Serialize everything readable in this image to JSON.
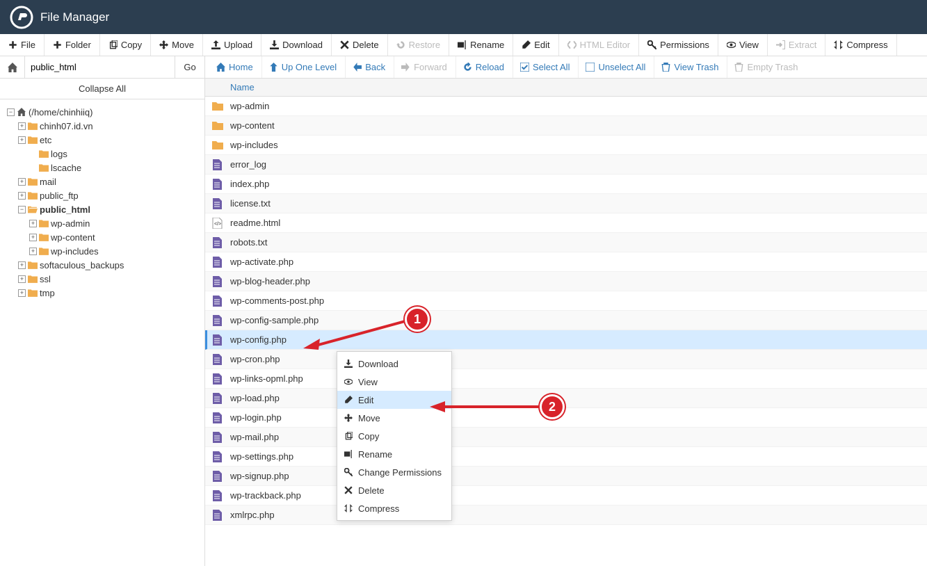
{
  "app_title": "File Manager",
  "toolbar": [
    {
      "id": "file",
      "label": "File",
      "icon": "plus"
    },
    {
      "id": "folder",
      "label": "Folder",
      "icon": "plus"
    },
    {
      "id": "copy",
      "label": "Copy",
      "icon": "copy"
    },
    {
      "id": "move",
      "label": "Move",
      "icon": "move"
    },
    {
      "id": "upload",
      "label": "Upload",
      "icon": "upload"
    },
    {
      "id": "download",
      "label": "Download",
      "icon": "download"
    },
    {
      "id": "delete",
      "label": "Delete",
      "icon": "x"
    },
    {
      "id": "restore",
      "label": "Restore",
      "icon": "restore",
      "disabled": true
    },
    {
      "id": "rename",
      "label": "Rename",
      "icon": "rename"
    },
    {
      "id": "edit",
      "label": "Edit",
      "icon": "pencil"
    },
    {
      "id": "htmleditor",
      "label": "HTML Editor",
      "icon": "code",
      "disabled": true
    },
    {
      "id": "permissions",
      "label": "Permissions",
      "icon": "key"
    },
    {
      "id": "view",
      "label": "View",
      "icon": "eye"
    },
    {
      "id": "extract",
      "label": "Extract",
      "icon": "extract",
      "disabled": true
    },
    {
      "id": "compress",
      "label": "Compress",
      "icon": "compress"
    }
  ],
  "path_input": "public_html",
  "go_label": "Go",
  "collapse_label": "Collapse All",
  "tree_root_label": "(/home/chinhiiq)",
  "tree": [
    {
      "depth": 0,
      "toggle": "-",
      "icon": "home",
      "label": "(/home/chinhiiq)"
    },
    {
      "depth": 1,
      "toggle": "+",
      "icon": "folder",
      "label": "chinh07.id.vn"
    },
    {
      "depth": 1,
      "toggle": "+",
      "icon": "folder",
      "label": "etc"
    },
    {
      "depth": 2,
      "toggle": " ",
      "icon": "folder",
      "label": "logs"
    },
    {
      "depth": 2,
      "toggle": " ",
      "icon": "folder",
      "label": "lscache"
    },
    {
      "depth": 1,
      "toggle": "+",
      "icon": "folder",
      "label": "mail"
    },
    {
      "depth": 1,
      "toggle": "+",
      "icon": "folder",
      "label": "public_ftp"
    },
    {
      "depth": 1,
      "toggle": "-",
      "icon": "folder-open",
      "label": "public_html",
      "bold": true
    },
    {
      "depth": 2,
      "toggle": "+",
      "icon": "folder",
      "label": "wp-admin"
    },
    {
      "depth": 2,
      "toggle": "+",
      "icon": "folder",
      "label": "wp-content"
    },
    {
      "depth": 2,
      "toggle": "+",
      "icon": "folder",
      "label": "wp-includes"
    },
    {
      "depth": 1,
      "toggle": "+",
      "icon": "folder",
      "label": "softaculous_backups"
    },
    {
      "depth": 1,
      "toggle": "+",
      "icon": "folder",
      "label": "ssl"
    },
    {
      "depth": 1,
      "toggle": "+",
      "icon": "folder",
      "label": "tmp"
    }
  ],
  "main_toolbar": [
    {
      "id": "home",
      "label": "Home",
      "icon": "home"
    },
    {
      "id": "up",
      "label": "Up One Level",
      "icon": "up"
    },
    {
      "id": "back",
      "label": "Back",
      "icon": "left"
    },
    {
      "id": "forward",
      "label": "Forward",
      "icon": "right",
      "disabled": true
    },
    {
      "id": "reload",
      "label": "Reload",
      "icon": "reload"
    },
    {
      "id": "selectall",
      "label": "Select All",
      "icon": "check"
    },
    {
      "id": "unselectall",
      "label": "Unselect All",
      "icon": "uncheck"
    },
    {
      "id": "viewtrash",
      "label": "View Trash",
      "icon": "trash"
    },
    {
      "id": "emptytrash",
      "label": "Empty Trash",
      "icon": "trash",
      "disabled": true
    }
  ],
  "column_header": "Name",
  "files": [
    {
      "name": "wp-admin",
      "type": "folder"
    },
    {
      "name": "wp-content",
      "type": "folder"
    },
    {
      "name": "wp-includes",
      "type": "folder"
    },
    {
      "name": "error_log",
      "type": "file"
    },
    {
      "name": "index.php",
      "type": "file"
    },
    {
      "name": "license.txt",
      "type": "file"
    },
    {
      "name": "readme.html",
      "type": "html"
    },
    {
      "name": "robots.txt",
      "type": "file"
    },
    {
      "name": "wp-activate.php",
      "type": "file"
    },
    {
      "name": "wp-blog-header.php",
      "type": "file"
    },
    {
      "name": "wp-comments-post.php",
      "type": "file"
    },
    {
      "name": "wp-config-sample.php",
      "type": "file"
    },
    {
      "name": "wp-config.php",
      "type": "file",
      "selected": true
    },
    {
      "name": "wp-cron.php",
      "type": "file"
    },
    {
      "name": "wp-links-opml.php",
      "type": "file"
    },
    {
      "name": "wp-load.php",
      "type": "file"
    },
    {
      "name": "wp-login.php",
      "type": "file"
    },
    {
      "name": "wp-mail.php",
      "type": "file"
    },
    {
      "name": "wp-settings.php",
      "type": "file"
    },
    {
      "name": "wp-signup.php",
      "type": "file"
    },
    {
      "name": "wp-trackback.php",
      "type": "file"
    },
    {
      "name": "xmlrpc.php",
      "type": "file"
    }
  ],
  "ctx": [
    {
      "label": "Download",
      "icon": "download"
    },
    {
      "label": "View",
      "icon": "eye"
    },
    {
      "label": "Edit",
      "icon": "pencil",
      "hl": true
    },
    {
      "label": "Move",
      "icon": "move"
    },
    {
      "label": "Copy",
      "icon": "copy"
    },
    {
      "label": "Rename",
      "icon": "rename"
    },
    {
      "label": "Change Permissions",
      "icon": "key"
    },
    {
      "label": "Delete",
      "icon": "x"
    },
    {
      "label": "Compress",
      "icon": "compress"
    }
  ],
  "annotations": {
    "one": "1",
    "two": "2"
  }
}
